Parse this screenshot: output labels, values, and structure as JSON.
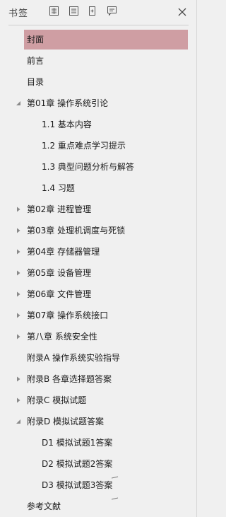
{
  "panel": {
    "title": "书签",
    "toolbar": [
      {
        "icon": "expand-all-icon"
      },
      {
        "icon": "collapse-all-icon"
      },
      {
        "icon": "add-bookmark-icon"
      },
      {
        "icon": "bookmark-options-icon"
      }
    ],
    "close_icon": "close-icon",
    "selected_color": "#cf9ea3"
  },
  "bookmarks": [
    {
      "label": "封面",
      "level": 0,
      "toggle": "none",
      "selected": true
    },
    {
      "label": "前言",
      "level": 0,
      "toggle": "none"
    },
    {
      "label": "目录",
      "level": 0,
      "toggle": "none"
    },
    {
      "label": "第01章 操作系统引论",
      "level": 0,
      "toggle": "expanded"
    },
    {
      "label": "1.1 基本内容",
      "level": 1,
      "toggle": "none"
    },
    {
      "label": "1.2 重点难点学习提示",
      "level": 1,
      "toggle": "none"
    },
    {
      "label": "1.3 典型问题分析与解答",
      "level": 1,
      "toggle": "none"
    },
    {
      "label": "1.4 习题",
      "level": 1,
      "toggle": "none"
    },
    {
      "label": "第02章 进程管理",
      "level": 0,
      "toggle": "collapsed"
    },
    {
      "label": "第03章 处理机调度与死锁",
      "level": 0,
      "toggle": "collapsed"
    },
    {
      "label": "第04章 存储器管理",
      "level": 0,
      "toggle": "collapsed"
    },
    {
      "label": "第05章 设备管理",
      "level": 0,
      "toggle": "collapsed"
    },
    {
      "label": "第06章 文件管理",
      "level": 0,
      "toggle": "collapsed"
    },
    {
      "label": "第07章 操作系统接口",
      "level": 0,
      "toggle": "collapsed"
    },
    {
      "label": "第八章 系统安全性",
      "level": 0,
      "toggle": "collapsed"
    },
    {
      "label": "附录A 操作系统实验指导",
      "level": 0,
      "toggle": "none"
    },
    {
      "label": "附录B 各章选择题答案",
      "level": 0,
      "toggle": "collapsed"
    },
    {
      "label": "附录C 模拟试题",
      "level": 0,
      "toggle": "collapsed"
    },
    {
      "label": "附录D 模拟试题答案",
      "level": 0,
      "toggle": "expanded"
    },
    {
      "label": "D1 模拟试题1答案",
      "level": 1,
      "toggle": "none"
    },
    {
      "label": "D2 模拟试题2答案",
      "level": 1,
      "toggle": "none",
      "mark": true
    },
    {
      "label": "D3 模拟试题3答案",
      "level": 1,
      "toggle": "none",
      "mark": true
    },
    {
      "label": "参考文献",
      "level": 0,
      "toggle": "none"
    }
  ]
}
